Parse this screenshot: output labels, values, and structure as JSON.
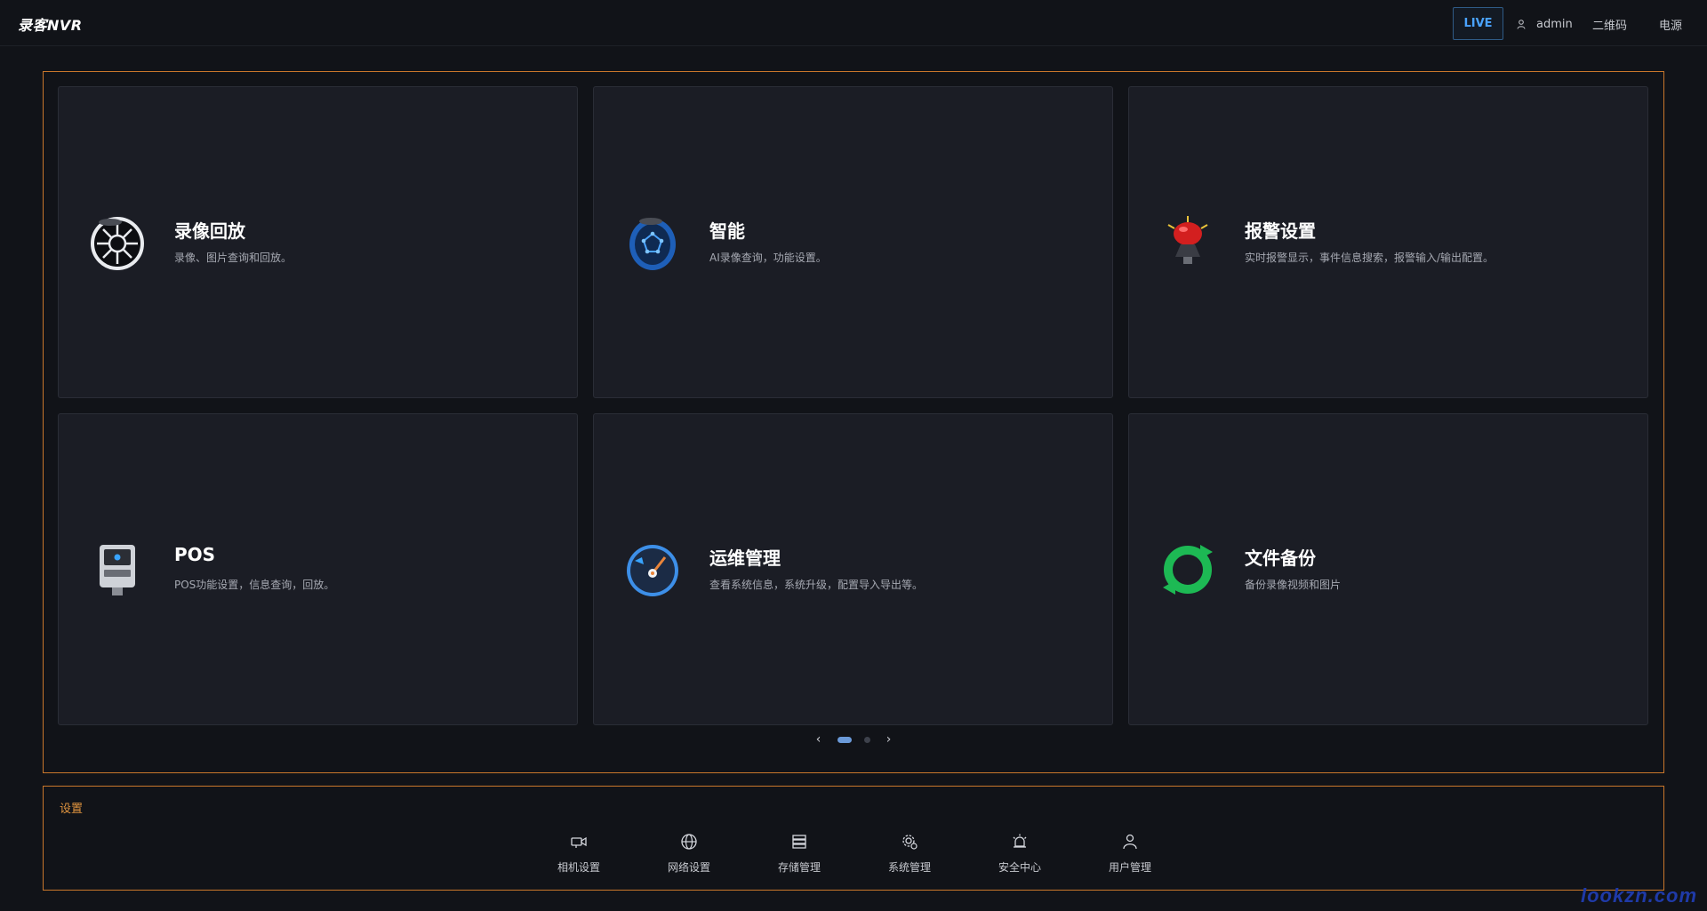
{
  "header": {
    "brand": "录客NVR",
    "live_label": "LIVE",
    "user_name": "admin",
    "qrcode_label": "二维码",
    "power_label": "电源"
  },
  "features": [
    {
      "title": "录像回放",
      "desc": "录像、图片查询和回放。",
      "icon": "playback-reel-icon"
    },
    {
      "title": "智能",
      "desc": "AI录像查询，功能设置。",
      "icon": "ai-smart-icon"
    },
    {
      "title": "报警设置",
      "desc": "实时报警显示，事件信息搜索，报警输入/输出配置。",
      "icon": "alarm-light-icon"
    },
    {
      "title": "POS",
      "desc": "POS功能设置，信息查询，回放。",
      "icon": "pos-terminal-icon"
    },
    {
      "title": "运维管理",
      "desc": "查看系统信息，系统升级，配置导入导出等。",
      "icon": "maintenance-gauge-icon"
    },
    {
      "title": "文件备份",
      "desc": "备份录像视频和图片",
      "icon": "backup-sync-icon"
    }
  ],
  "pager": {
    "prev": "‹",
    "next": "›",
    "pages": 2,
    "current": 1
  },
  "settings": {
    "title": "设置",
    "items": [
      {
        "label": "相机设置",
        "icon": "camera-icon"
      },
      {
        "label": "网络设置",
        "icon": "globe-icon"
      },
      {
        "label": "存储管理",
        "icon": "storage-icon"
      },
      {
        "label": "系统管理",
        "icon": "system-gear-icon"
      },
      {
        "label": "安全中心",
        "icon": "security-alarm-icon"
      },
      {
        "label": "用户管理",
        "icon": "user-icon"
      }
    ]
  },
  "watermark": "lookzn.com",
  "colors": {
    "accent_orange": "#c9772b",
    "live_blue": "#4aa3ff",
    "card_bg": "#1b1d25",
    "page_bg": "#111318"
  }
}
